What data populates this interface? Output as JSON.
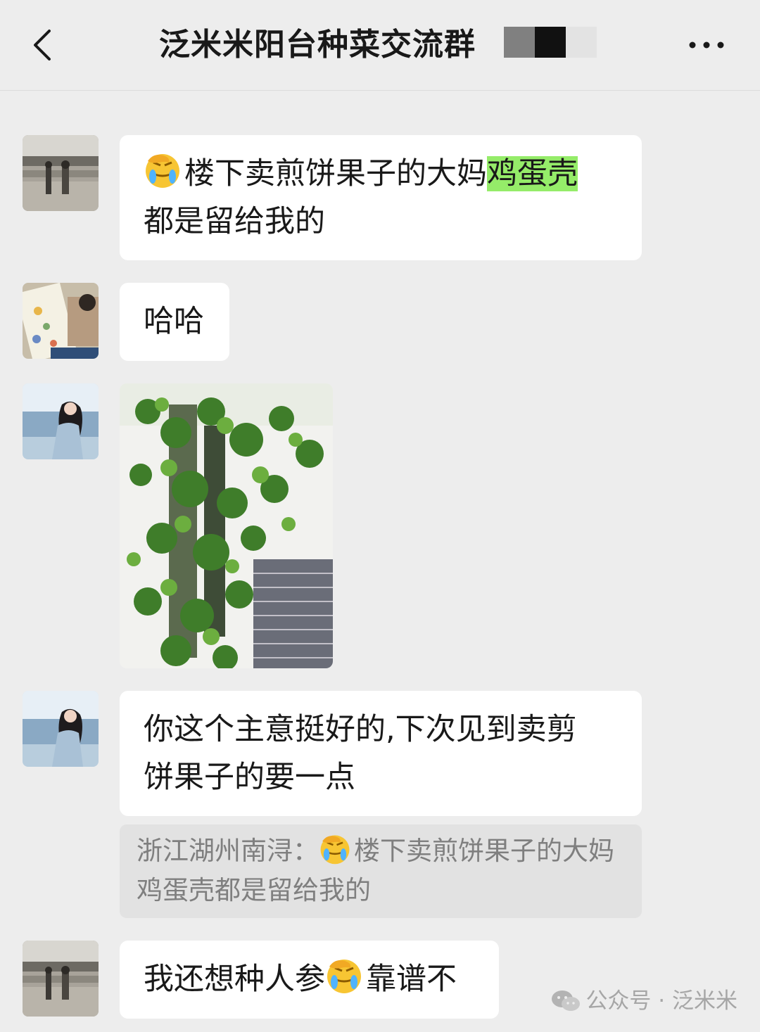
{
  "header": {
    "back_icon": "chevron-left-icon",
    "title": "泛米米阳台种菜交流群",
    "more_icon": "more-dots-icon"
  },
  "messages": [
    {
      "type": "text",
      "avatar": "avatar-mall",
      "line1_emoji": "facepalm-crying-emoji",
      "line1_text": "楼下卖煎饼果子的大妈",
      "line1_highlight": "鸡蛋壳",
      "line2_text": "都是留给我的"
    },
    {
      "type": "text",
      "avatar": "avatar-book",
      "text": "哈哈"
    },
    {
      "type": "image",
      "avatar": "avatar-woman-sea",
      "image": "climbing-plant-photo"
    },
    {
      "type": "text",
      "avatar": "avatar-woman-sea",
      "line1_text": "你这个主意挺好的,下次见到卖剪",
      "line2_text": "饼果子的要一点",
      "quote": {
        "author": "浙江湖州南浔：",
        "emoji": "facepalm-crying-emoji",
        "line1_text": "楼下卖煎饼果子的大妈",
        "line2_text": "鸡蛋壳都是留给我的"
      }
    },
    {
      "type": "text",
      "avatar": "avatar-mall",
      "before_emoji": "我还想种人参",
      "emoji": "facepalm-crying-emoji",
      "after_emoji": "靠谱不"
    }
  ],
  "watermark": {
    "icon": "wechat-icon",
    "text": "公众号 · 泛米米"
  },
  "colors": {
    "background": "#ededed",
    "bubble": "#ffffff",
    "highlight": "#95ec69",
    "quote_bg": "#e2e2e2"
  }
}
